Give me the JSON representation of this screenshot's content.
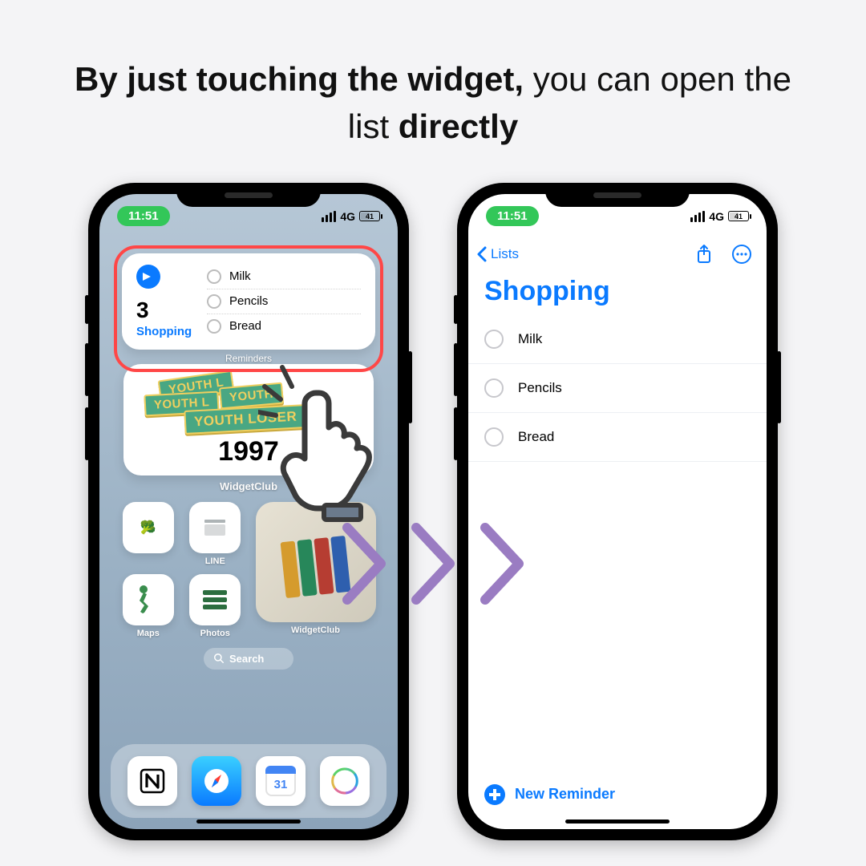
{
  "headline": {
    "p1": "By just touching the widget, ",
    "p2": "you can open the list ",
    "p3": "directly"
  },
  "status": {
    "time": "11:51",
    "net": "4G",
    "battery": "41"
  },
  "left": {
    "widget": {
      "count": "3",
      "list_name": "Shopping",
      "items": [
        "Milk",
        "Pencils",
        "Bread"
      ],
      "app_label": "Reminders"
    },
    "wc": {
      "sticker_a": "YOUTH L",
      "sticker_b": "YOUTH L",
      "sticker_c": "YOUTH",
      "sticker_d": "YOUTH  LOSER",
      "year": "1997",
      "label": "WidgetClub"
    },
    "apps": {
      "a1": "",
      "a2": "LINE",
      "a3": "Maps",
      "a4": "Photos",
      "big": "WidgetClub"
    },
    "search": "Search",
    "dock_cal_day": "31"
  },
  "right": {
    "back_label": "Lists",
    "title": "Shopping",
    "items": [
      "Milk",
      "Pencils",
      "Bread"
    ],
    "new_reminder": "New Reminder"
  },
  "colors": {
    "accent": "#0a7aff",
    "highlight": "#ff4747",
    "arrow": "#9a7cc2"
  }
}
